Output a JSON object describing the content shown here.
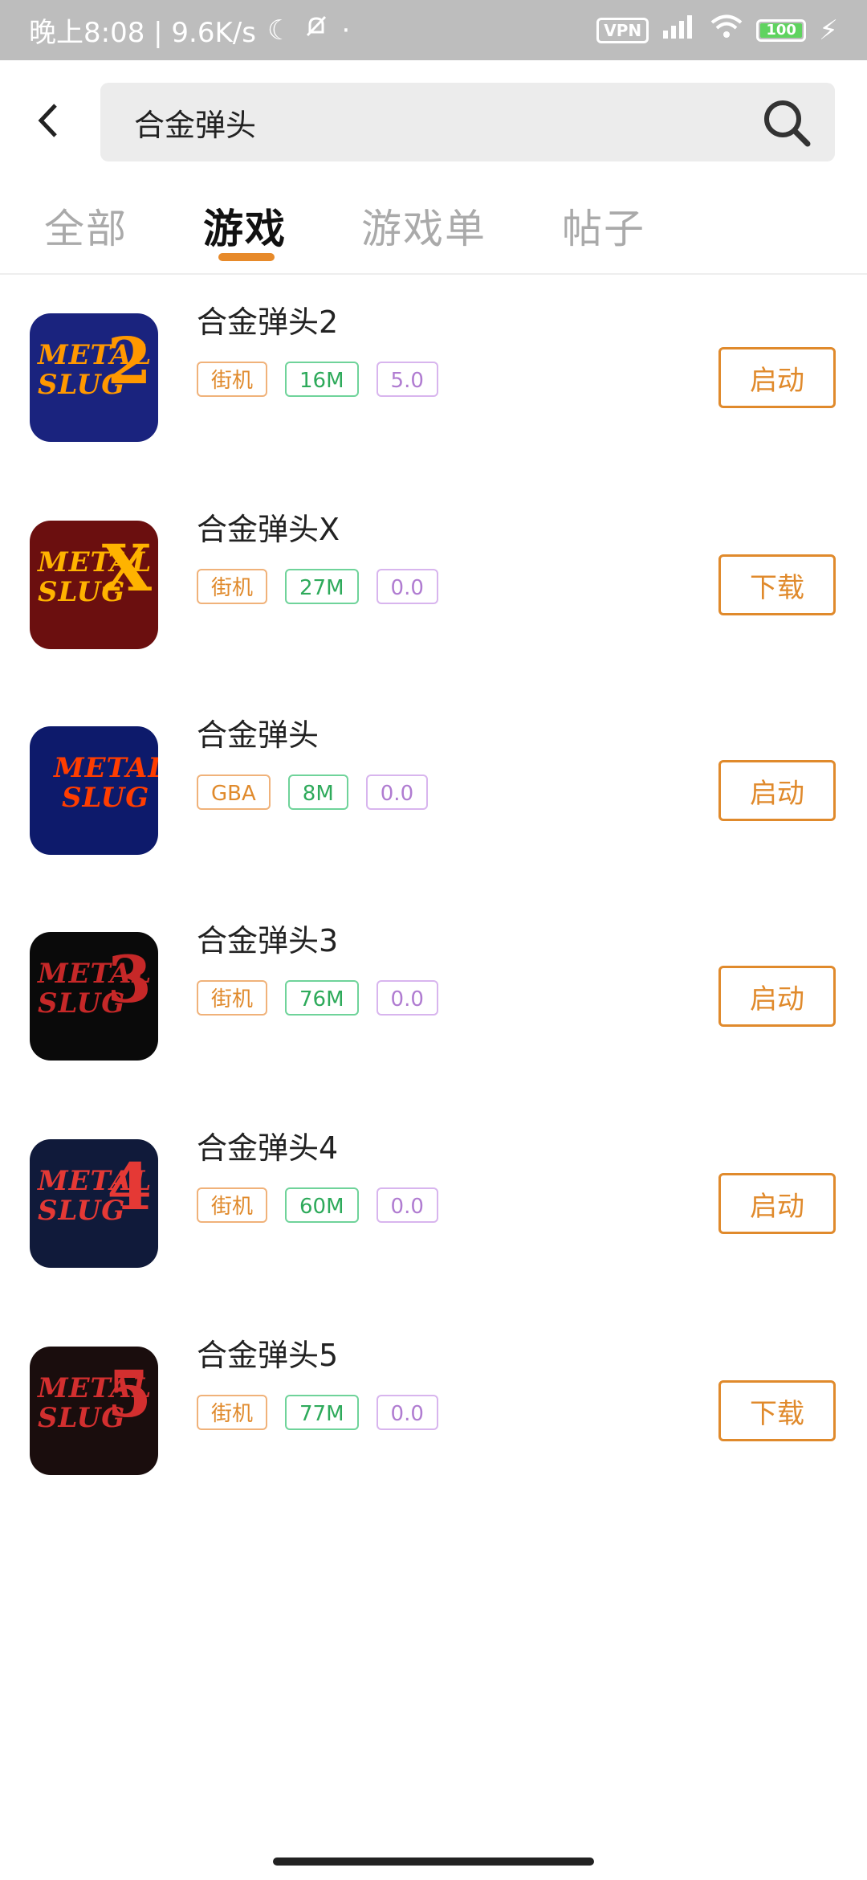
{
  "status_bar": {
    "time_speed": "晚上8:08 | 9.6K/s",
    "vpn": "VPN",
    "battery": "100"
  },
  "header": {
    "search_value": "合金弹头"
  },
  "tabs": [
    {
      "label": "全部"
    },
    {
      "label": "游戏"
    },
    {
      "label": "游戏单"
    },
    {
      "label": "帖子"
    }
  ],
  "active_tab": "游戏",
  "items": [
    {
      "title": "合金弹头2",
      "category": "街机",
      "size": "16M",
      "score": "5.0",
      "action": "启动",
      "logo1": "METAL",
      "logo2": "SLUG",
      "logo_num": "2",
      "colors": {
        "bg": "#1a237e",
        "logo": "#ff9800"
      }
    },
    {
      "title": "合金弹头X",
      "category": "街机",
      "size": "27M",
      "score": "0.0",
      "action": "下载",
      "logo1": "METAL",
      "logo2": "SLUG",
      "logo_num": "X",
      "colors": {
        "bg": "#6b0f0f",
        "logo": "#ffb300"
      }
    },
    {
      "title": "合金弹头",
      "category": "GBA",
      "size": "8M",
      "score": "0.0",
      "action": "启动",
      "logo1": "METAL",
      "logo2": "SLUG",
      "logo_num": "",
      "colors": {
        "bg": "#0d1a6b",
        "logo": "#ff3d00"
      }
    },
    {
      "title": "合金弹头3",
      "category": "街机",
      "size": "76M",
      "score": "0.0",
      "action": "启动",
      "logo1": "METAL",
      "logo2": "SLUG",
      "logo_num": "3",
      "colors": {
        "bg": "#0a0a0a",
        "logo": "#c62828"
      }
    },
    {
      "title": "合金弹头4",
      "category": "街机",
      "size": "60M",
      "score": "0.0",
      "action": "启动",
      "logo1": "METAL",
      "logo2": "SLUG",
      "logo_num": "4",
      "colors": {
        "bg": "#101a3a",
        "logo": "#e53935"
      }
    },
    {
      "title": "合金弹头5",
      "category": "街机",
      "size": "77M",
      "score": "0.0",
      "action": "下载",
      "logo1": "METAL",
      "logo2": "SLUG",
      "logo_num": "5",
      "colors": {
        "bg": "#1a0d0d",
        "logo": "#d32f2f"
      }
    }
  ]
}
